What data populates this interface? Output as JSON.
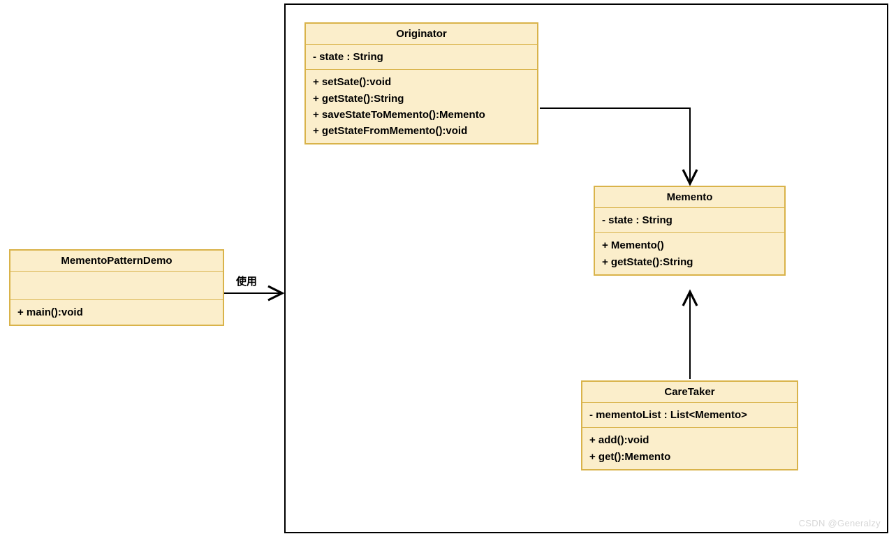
{
  "classes": {
    "demo": {
      "name": "MementoPatternDemo",
      "attrs": [],
      "ops": [
        "+ main():void"
      ]
    },
    "originator": {
      "name": "Originator",
      "attrs": [
        "- state : String"
      ],
      "ops": [
        "+ setSate():void",
        "+ getState():String",
        "+ saveStateToMemento():Memento",
        "+ getStateFromMemento():void"
      ]
    },
    "memento": {
      "name": "Memento",
      "attrs": [
        "- state : String"
      ],
      "ops": [
        "+ Memento()",
        "+ getState():String"
      ]
    },
    "caretaker": {
      "name": "CareTaker",
      "attrs": [
        "- mementoList : List<Memento>"
      ],
      "ops": [
        "+ add():void",
        "+ get():Memento"
      ]
    }
  },
  "labels": {
    "uses": "使用"
  },
  "watermark": "CSDN @Generalzy"
}
